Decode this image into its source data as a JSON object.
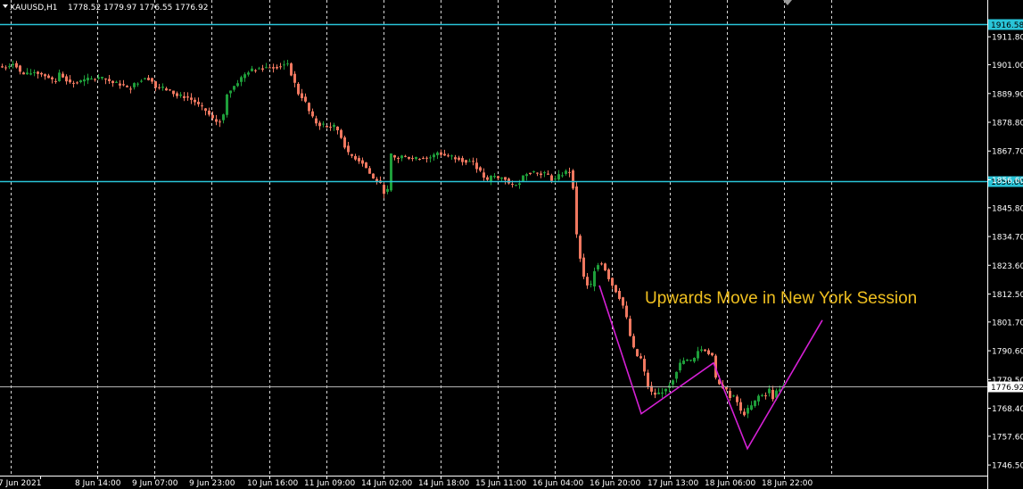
{
  "window": {
    "symbol": "XAUUSD,H1",
    "ohlc": "1778.52 1779.97 1776.55 1776.92"
  },
  "colors": {
    "background": "#000000",
    "grid": "#ffffff",
    "bull": "#1e9e3a",
    "bear": "#f07860",
    "level": "#29c4d8",
    "bid": "#b4b4b4",
    "zigzag": "#d520d5",
    "annotation": "#f0c020"
  },
  "chart_data": {
    "type": "candlestick",
    "timeframe": "H1",
    "ylim": [
      1742.4,
      1926.0
    ],
    "y_ticks": [
      "1911.80",
      "1901.00",
      "1889.90",
      "1878.80",
      "1867.70",
      "1856.60",
      "1845.80",
      "1834.70",
      "1823.60",
      "1812.50",
      "1801.70",
      "1790.60",
      "1779.50",
      "1768.40",
      "1757.60",
      "1746.50"
    ],
    "x_ticks": [
      "7 Jun 2021",
      "8 Jun 14:00",
      "9 Jun 07:00",
      "9 Jun 23:00",
      "10 Jun 16:00",
      "11 Jun 09:00",
      "14 Jun 02:00",
      "14 Jun 18:00",
      "15 Jun 11:00",
      "16 Jun 04:00",
      "16 Jun 20:00",
      "17 Jun 13:00",
      "18 Jun 06:00",
      "18 Jun 22:00"
    ],
    "price_profile": [
      [
        0,
        1900.4
      ],
      [
        6,
        1899.8
      ],
      [
        12,
        1900.8
      ],
      [
        18,
        1902.0
      ],
      [
        24,
        1898.0
      ],
      [
        30,
        1897.0
      ],
      [
        40,
        1898.3
      ],
      [
        55,
        1896.5
      ],
      [
        63,
        1893.6
      ],
      [
        67,
        1897.8
      ],
      [
        73,
        1896.3
      ],
      [
        80,
        1894.0
      ],
      [
        90,
        1894.4
      ],
      [
        100,
        1895.3
      ],
      [
        112,
        1895.8
      ],
      [
        120,
        1895.5
      ],
      [
        128,
        1894.0
      ],
      [
        138,
        1893.4
      ],
      [
        145,
        1891.5
      ],
      [
        155,
        1894.2
      ],
      [
        162,
        1896.0
      ],
      [
        170,
        1895.8
      ],
      [
        176,
        1892.3
      ],
      [
        185,
        1891.8
      ],
      [
        192,
        1891.0
      ],
      [
        200,
        1889.0
      ],
      [
        210,
        1888.7
      ],
      [
        220,
        1886.7
      ],
      [
        226,
        1884.6
      ],
      [
        232,
        1883.3
      ],
      [
        240,
        1880.0
      ],
      [
        246,
        1878.6
      ],
      [
        252,
        1881.6
      ],
      [
        256,
        1890.0
      ],
      [
        262,
        1892.0
      ],
      [
        270,
        1895.2
      ],
      [
        280,
        1898.5
      ],
      [
        290,
        1899.5
      ],
      [
        300,
        1900.0
      ],
      [
        310,
        1900.2
      ],
      [
        318,
        1901.0
      ],
      [
        324,
        1901.5
      ],
      [
        330,
        1895.5
      ],
      [
        336,
        1890.0
      ],
      [
        342,
        1888.0
      ],
      [
        348,
        1883.0
      ],
      [
        354,
        1879.0
      ],
      [
        362,
        1877.6
      ],
      [
        370,
        1876.9
      ],
      [
        378,
        1877.2
      ],
      [
        384,
        1873.0
      ],
      [
        392,
        1866.5
      ],
      [
        400,
        1865.0
      ],
      [
        408,
        1863.3
      ],
      [
        414,
        1860.0
      ],
      [
        420,
        1856.9
      ],
      [
        426,
        1856.0
      ],
      [
        432,
        1852.0
      ],
      [
        436,
        1852.5
      ],
      [
        440,
        1866.1
      ],
      [
        446,
        1864.5
      ],
      [
        452,
        1865.8
      ],
      [
        460,
        1865.0
      ],
      [
        466,
        1864.5
      ],
      [
        474,
        1865.2
      ],
      [
        480,
        1864.9
      ],
      [
        486,
        1865.5
      ],
      [
        492,
        1867.2
      ],
      [
        500,
        1866.0
      ],
      [
        508,
        1865.3
      ],
      [
        516,
        1865.0
      ],
      [
        524,
        1863.5
      ],
      [
        530,
        1864.1
      ],
      [
        536,
        1861.4
      ],
      [
        542,
        1858.4
      ],
      [
        548,
        1856.0
      ],
      [
        554,
        1858.5
      ],
      [
        560,
        1857.0
      ],
      [
        566,
        1858.0
      ],
      [
        572,
        1855.0
      ],
      [
        578,
        1854.0
      ],
      [
        584,
        1856.0
      ],
      [
        590,
        1859.1
      ],
      [
        596,
        1859.6
      ],
      [
        604,
        1859.0
      ],
      [
        610,
        1859.3
      ],
      [
        616,
        1858.3
      ],
      [
        622,
        1856.0
      ],
      [
        628,
        1858.0
      ],
      [
        634,
        1859.3
      ],
      [
        640,
        1860.2
      ],
      [
        644,
        1854.0
      ],
      [
        646,
        1845.0
      ],
      [
        648,
        1835.0
      ],
      [
        651,
        1829.0
      ],
      [
        654,
        1821.8
      ],
      [
        658,
        1816.5
      ],
      [
        664,
        1815.4
      ],
      [
        668,
        1822.0
      ],
      [
        674,
        1825.4
      ],
      [
        680,
        1822.0
      ],
      [
        686,
        1817.1
      ],
      [
        692,
        1813.7
      ],
      [
        698,
        1810.0
      ],
      [
        702,
        1806.0
      ],
      [
        706,
        1800.0
      ],
      [
        710,
        1792.6
      ],
      [
        716,
        1788.5
      ],
      [
        720,
        1787.5
      ],
      [
        726,
        1779.4
      ],
      [
        730,
        1774.7
      ],
      [
        736,
        1773.8
      ],
      [
        742,
        1774.3
      ],
      [
        748,
        1776.3
      ],
      [
        754,
        1778.2
      ],
      [
        760,
        1783.0
      ],
      [
        766,
        1786.7
      ],
      [
        772,
        1786.8
      ],
      [
        778,
        1786.2
      ],
      [
        784,
        1790.6
      ],
      [
        790,
        1791.3
      ],
      [
        796,
        1789.8
      ],
      [
        800,
        1788.7
      ],
      [
        804,
        1779.5
      ],
      [
        808,
        1777.5
      ],
      [
        814,
        1776.2
      ],
      [
        820,
        1773.0
      ],
      [
        826,
        1772.9
      ],
      [
        830,
        1768.6
      ],
      [
        834,
        1765.5
      ],
      [
        838,
        1767.2
      ],
      [
        842,
        1768.5
      ],
      [
        846,
        1770.0
      ],
      [
        852,
        1773.1
      ],
      [
        858,
        1773.5
      ],
      [
        864,
        1775.5
      ],
      [
        868,
        1772.5
      ],
      [
        872,
        1774.8
      ],
      [
        878,
        1776.9
      ]
    ],
    "levels": [
      {
        "price": 1916.58,
        "label": "1916.58"
      },
      {
        "price": 1856.0,
        "label": "1856.00"
      }
    ],
    "bid": {
      "price": 1776.92,
      "label": "1776.92"
    },
    "zigzag": [
      {
        "t": 672,
        "p": 1815.8
      },
      {
        "t": 719,
        "p": 1766.3
      },
      {
        "t": 800,
        "p": 1785.9
      },
      {
        "t": 838,
        "p": 1752.8
      },
      {
        "t": 922,
        "p": 1802.4
      }
    ],
    "annotation": {
      "text": "Upwards Move in New York Session"
    }
  }
}
